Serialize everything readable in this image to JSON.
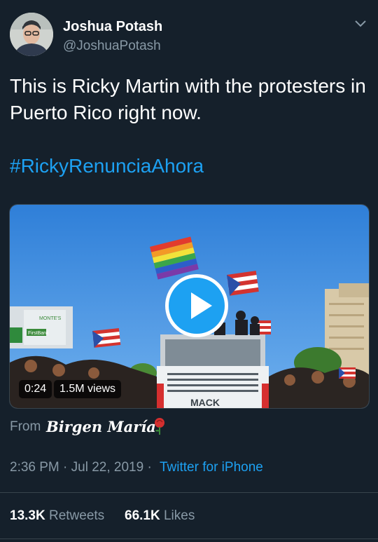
{
  "author": {
    "name": "Joshua Potash",
    "handle": "@JoshuaPotash"
  },
  "tweet": {
    "text": "This is Ricky Martin with the protesters in Puerto Rico right now.",
    "hashtag": "#RickyRenunciaAhora"
  },
  "media": {
    "duration": "0:24",
    "views": "1.5M views",
    "truck_brand": "MACK",
    "bank_sign": "FirstBank",
    "building_sign": "MONTE'S"
  },
  "source": {
    "from_label": "From",
    "name": "Birgen María"
  },
  "meta": {
    "time_date": "2:36 PM · Jul 22, 2019 ·",
    "client": "Twitter for iPhone"
  },
  "stats": {
    "retweets_count": "13.3K",
    "retweets_label": "Retweets",
    "likes_count": "66.1K",
    "likes_label": "Likes"
  },
  "colors": {
    "background": "#15202b",
    "accent": "#1da1f2",
    "secondary_text": "#8899a6",
    "divider": "#38444d"
  },
  "icons": {
    "menu": "chevron-down-icon",
    "play": "play-icon",
    "source": "rose-icon"
  }
}
